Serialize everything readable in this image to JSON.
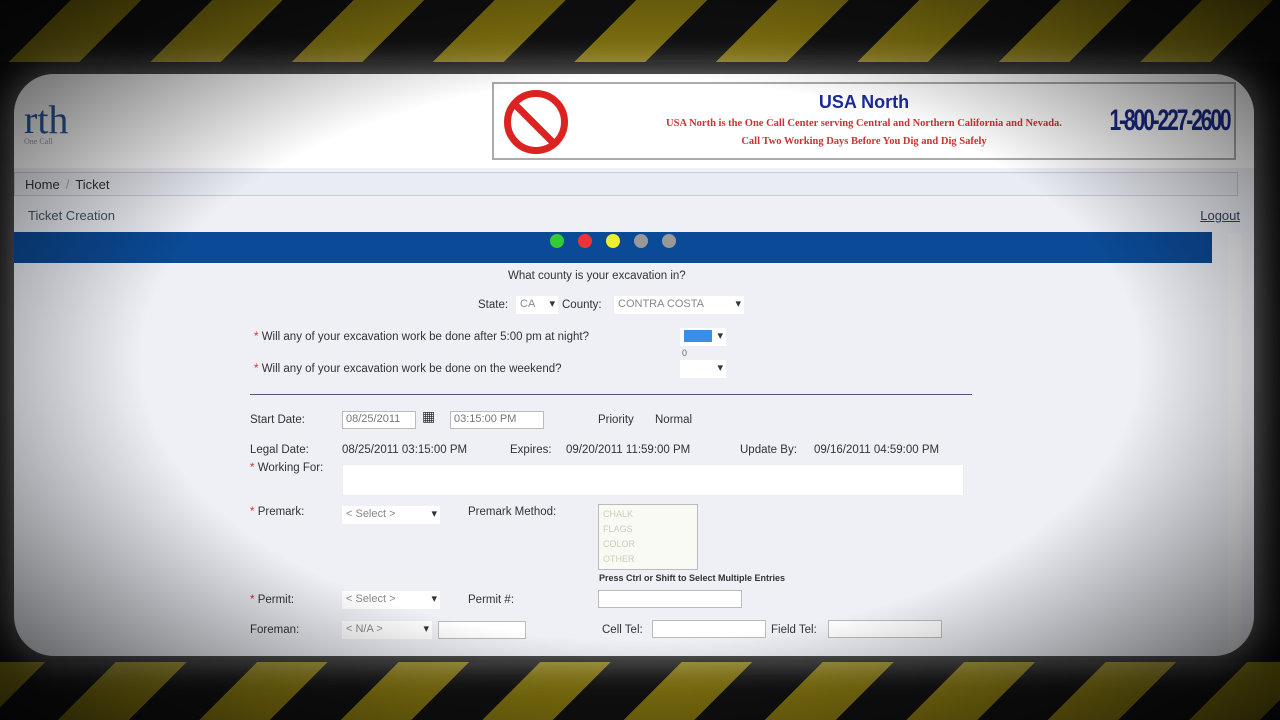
{
  "logo": {
    "text": "rth",
    "tagline": "One Call"
  },
  "banner": {
    "title": "USA North",
    "line1": "USA North is the One Call Center serving Central and Northern California and Nevada.",
    "line2": "Call Two Working Days Before You Dig and Dig Safely",
    "phone": "1-800-227-2600"
  },
  "breadcrumb": [
    "Home",
    "/",
    "Ticket"
  ],
  "subtitle": "Ticket Creation",
  "logout": "Logout",
  "step_dots": [
    "#3c3",
    "#e33",
    "#ee3",
    "#999",
    "#999"
  ],
  "form": {
    "county_q": "What county is your excavation in?",
    "state_label": "State:",
    "state": "CA",
    "county_label": "County:",
    "county": "CONTRA COSTA",
    "night_q": "Will any of your excavation work be done after 5:00 pm at night?",
    "night_option": "0",
    "weekend_q": "Will any of your excavation work be done on the weekend?",
    "star": "*",
    "start_label": "Start Date:",
    "start_date": "08/25/2011",
    "start_time": "03:15:00 PM",
    "priority_label": "Priority",
    "priority": "Normal",
    "legal_label": "Legal Date:",
    "legal": "08/25/2011 03:15:00 PM",
    "expires_label": "Expires:",
    "expires": "09/20/2011 11:59:00 PM",
    "update_label": "Update By:",
    "update": "09/16/2011 04:59:00 PM",
    "working_label": "Working For:",
    "premark_label": "Premark:",
    "premark": "< Select >",
    "premark_method_label": "Premark Method:",
    "premark_methods": [
      "CHALK",
      "FLAGS",
      "COLOR",
      "OTHER"
    ],
    "multi_hint": "Press Ctrl or Shift to Select Multiple Entries",
    "permit_label": "Permit:",
    "permit": "< Select >",
    "permit_no_label": "Permit #:",
    "foreman_label": "Foreman:",
    "foreman": "< N/A >",
    "cell_label": "Cell Tel:",
    "field_label": "Field Tel:"
  }
}
